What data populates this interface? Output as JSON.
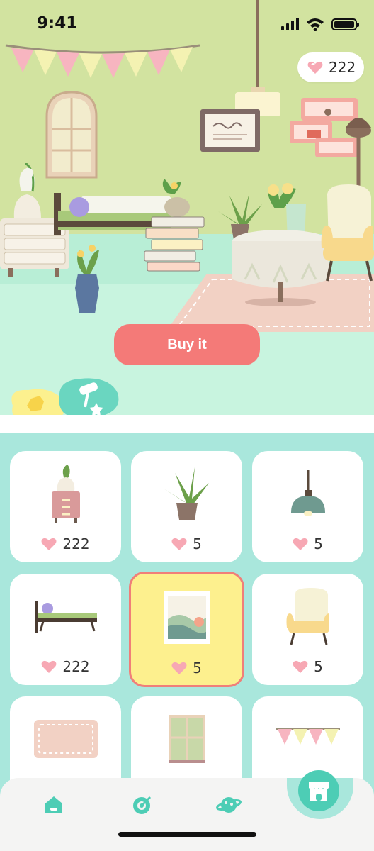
{
  "status_bar": {
    "time": "9:41"
  },
  "currency": {
    "balance": "222"
  },
  "buy_button": {
    "label": "Buy it"
  },
  "items": [
    {
      "name": "cabinet-with-plant",
      "price": "222",
      "selected": false
    },
    {
      "name": "potted-plant",
      "price": "5",
      "selected": false
    },
    {
      "name": "pendant-lamp",
      "price": "5",
      "selected": false
    },
    {
      "name": "bed",
      "price": "222",
      "selected": false
    },
    {
      "name": "wall-painting",
      "price": "5",
      "selected": true
    },
    {
      "name": "armchair",
      "price": "5",
      "selected": false
    },
    {
      "name": "rug",
      "price": "",
      "selected": false
    },
    {
      "name": "window",
      "price": "",
      "selected": false
    },
    {
      "name": "bunting",
      "price": "",
      "selected": false
    }
  ],
  "nav": {
    "items": [
      "home-icon",
      "target-icon",
      "planet-icon",
      "shop-icon"
    ],
    "active": "shop-icon"
  },
  "colors": {
    "wall": "#d2e3a0",
    "floor": "#c8f4df",
    "grid_bg": "#a9e7dc",
    "accent": "#f47a78",
    "selected_bg": "#fdf08e",
    "teal": "#4dcdb5"
  }
}
